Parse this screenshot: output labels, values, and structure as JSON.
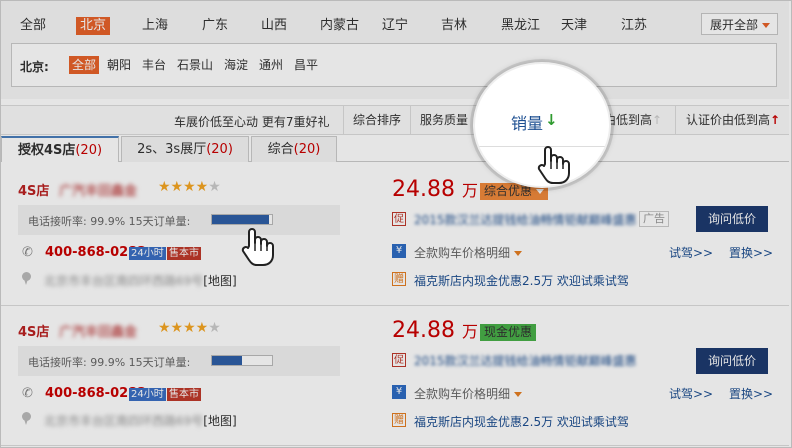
{
  "provinces": [
    "全部",
    "北京",
    "上海",
    "广东",
    "山西",
    "内蒙古",
    "辽宁",
    "吉林",
    "黑龙江",
    "天津",
    "江苏"
  ],
  "active_province": "北京",
  "expand_all_label": "展开全部",
  "city_filter": {
    "label": "北京:",
    "cities": [
      "全部",
      "朝阳",
      "丰台",
      "石景山",
      "海淀",
      "通州",
      "昌平"
    ],
    "active": "全部"
  },
  "promo_text": "车展价低至心动 更有7重好礼",
  "sort_tabs": [
    {
      "label": "综合排序"
    },
    {
      "label": "服务质量"
    },
    {
      "label": "销量",
      "arrow": "↓"
    },
    {
      "label": "价由低到高",
      "arrow": "↑"
    },
    {
      "label": "认证价由低到高",
      "arrow": "↑"
    }
  ],
  "shop_tabs": [
    {
      "label": "授权4S店",
      "count": "(20)",
      "active": true
    },
    {
      "label": "2s、3s展厅",
      "count": "(20)",
      "active": false
    },
    {
      "label": "综合",
      "count": "(20)",
      "active": false
    }
  ],
  "listings": [
    {
      "type_badge": "4S店",
      "dealer_name": "广汽丰田鑫金",
      "stars": 4,
      "stars_max": 5,
      "stat_text": "电话接听率: 99.9% 15天订单量:",
      "order_bar_level": 0.95,
      "phone": "400-868-0282",
      "tag_24h": "24小时",
      "tag_city": "售本市",
      "address_text": "北京市丰台区南四环西路69号",
      "map_label": "[地图]",
      "price": "24.88",
      "price_unit": "万",
      "price_tag": "综合优惠",
      "promo_line": "2015款汉兰达提钱给油畅情钜献巅峰盛惠",
      "ad_label": "广告",
      "detail_line": "全款购车价格明细",
      "gift_line": "福克斯店内现金优惠2.5万 欢迎试乘试驾",
      "inquiry_label": "询问低价",
      "test_drive_label": "试驾>>",
      "trade_in_label": "置换>>"
    },
    {
      "type_badge": "4S店",
      "dealer_name": "广汽丰田鑫金",
      "stars": 4,
      "stars_max": 5,
      "stat_text": "电话接听率: 99.9% 15天订单量:",
      "order_bar_level": 0.5,
      "phone": "400-868-0282",
      "tag_24h": "24小时",
      "tag_city": "售本市",
      "address_text": "北京市丰台区南四环西路69号",
      "map_label": "[地图]",
      "price": "24.88",
      "price_unit": "万",
      "price_tag": "现金优惠",
      "promo_line": "2015款汉兰达提钱给油畅情钜献巅峰盛惠",
      "ad_label": "",
      "detail_line": "全款购车价格明细",
      "gift_line": "福克斯店内现金优惠2.5万 欢迎试乘试驾",
      "inquiry_label": "询问低价",
      "test_drive_label": "试驾>>",
      "trade_in_label": "置换>>"
    }
  ],
  "colors": {
    "accent": "#e8622a",
    "price_red": "#c00000",
    "button_navy": "#1e3a70",
    "link_blue": "#1d4f91"
  },
  "icons": [
    "phone-icon",
    "location-icon",
    "promo-icon",
    "yen-icon",
    "gift-icon",
    "hand-cursor-icon"
  ]
}
